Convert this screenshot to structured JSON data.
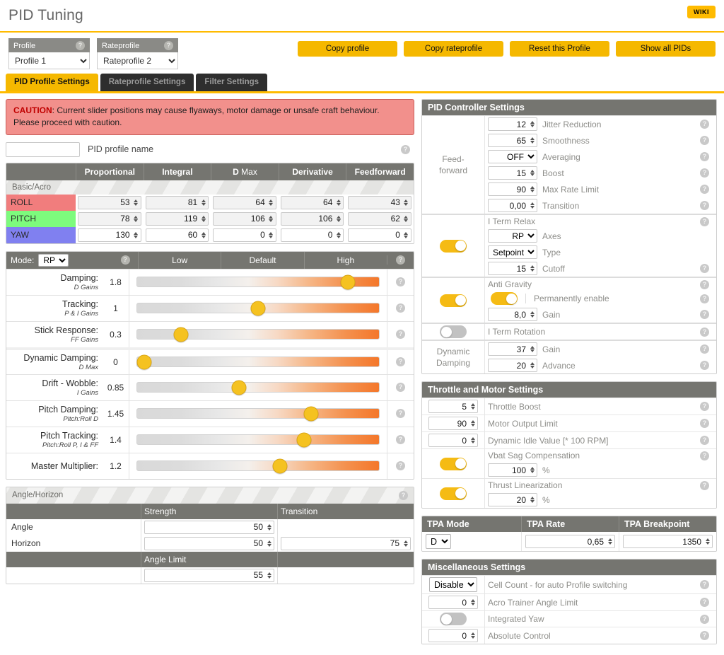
{
  "header": {
    "title": "PID Tuning",
    "wiki_label": "WIKI"
  },
  "profile_bar": {
    "profile": {
      "label": "Profile",
      "value": "Profile 1"
    },
    "rateprofile": {
      "label": "Rateprofile",
      "value": "Rateprofile 2"
    },
    "buttons": [
      {
        "label": "Copy profile"
      },
      {
        "label": "Copy rateprofile"
      },
      {
        "label": "Reset this Profile"
      },
      {
        "label": "Show all PIDs"
      }
    ]
  },
  "tabs": [
    {
      "label": "PID Profile Settings",
      "active": true
    },
    {
      "label": "Rateprofile Settings",
      "active": false
    },
    {
      "label": "Filter Settings",
      "active": false
    }
  ],
  "caution": {
    "prefix": "CAUTION",
    "text": ": Current slider positions may cause flyaways, motor damage or unsafe craft behaviour. Please proceed with caution."
  },
  "profile_name": {
    "value": "",
    "label": "PID profile name"
  },
  "pid_table": {
    "columns": [
      "",
      "Proportional",
      "Integral",
      "D Max",
      "Derivative",
      "Feedforward"
    ],
    "dmax_bold": "D",
    "dmax_rest": " Max",
    "section_label": "Basic/Acro",
    "rows": [
      {
        "axis": "ROLL",
        "values": [
          "53",
          "81",
          "64",
          "64",
          "43"
        ]
      },
      {
        "axis": "PITCH",
        "values": [
          "78",
          "119",
          "106",
          "106",
          "62"
        ]
      },
      {
        "axis": "YAW",
        "values": [
          "130",
          "60",
          "0",
          "0",
          "0"
        ]
      }
    ]
  },
  "sliders": {
    "mode_label": "Mode:",
    "mode_value": "RP",
    "columns": [
      "Low",
      "Default",
      "High"
    ],
    "rows": [
      {
        "title": "Damping:",
        "sub": "D Gains",
        "value": "1.8",
        "pos": 87
      },
      {
        "title": "Tracking:",
        "sub": "P & I Gains",
        "value": "1",
        "pos": 50
      },
      {
        "title": "Stick Response:",
        "sub": "FF Gains",
        "value": "0.3",
        "pos": 18
      },
      {
        "title": "Dynamic Damping:",
        "sub": "D Max",
        "value": "0",
        "pos": 3,
        "gap": true
      },
      {
        "title": "Drift - Wobble:",
        "sub": "I Gains",
        "value": "0.85",
        "pos": 42
      },
      {
        "title": "Pitch Damping:",
        "sub": "Pitch:Roll D",
        "value": "1.45",
        "pos": 72
      },
      {
        "title": "Pitch Tracking:",
        "sub": "Pitch:Roll P, I & FF",
        "value": "1.4",
        "pos": 69
      },
      {
        "title": "Master Multiplier:",
        "sub": "",
        "value": "1.2",
        "pos": 59
      }
    ]
  },
  "angle_horizon": {
    "title": "Angle/Horizon",
    "col_strength": "Strength",
    "col_transition": "Transition",
    "col_angle_limit": "Angle Limit",
    "angle_label": "Angle",
    "horizon_label": "Horizon",
    "angle_strength": "50",
    "horizon_strength": "50",
    "horizon_transition": "75",
    "angle_limit": "55"
  },
  "pid_controller": {
    "title": "PID Controller Settings",
    "feedforward_label_1": "Feed-",
    "feedforward_label_2": "forward",
    "feedforward": [
      {
        "value": "12",
        "label": "Jitter Reduction"
      },
      {
        "value": "65",
        "label": "Smoothness"
      },
      {
        "value": "OFF",
        "label": "Averaging",
        "select": true
      },
      {
        "value": "15",
        "label": "Boost"
      },
      {
        "value": "90",
        "label": "Max Rate Limit"
      },
      {
        "value": "0,00",
        "label": "Transition"
      }
    ],
    "iterm_relax": {
      "label": "I Term Relax",
      "enabled": true,
      "axes_value": "RP",
      "axes_label": "Axes",
      "type_value": "Setpoint",
      "type_label": "Type",
      "cutoff_value": "15",
      "cutoff_label": "Cutoff"
    },
    "anti_gravity": {
      "label": "Anti Gravity",
      "enabled": true,
      "permanent_label": "Permanently enable",
      "permanent_enabled": true,
      "gain_value": "8,0",
      "gain_label": "Gain"
    },
    "iterm_rotation": {
      "label": "I Term Rotation",
      "enabled": false
    },
    "dynamic_damping": {
      "label_1": "Dynamic",
      "label_2": "Damping",
      "gain_value": "37",
      "gain_label": "Gain",
      "advance_value": "20",
      "advance_label": "Advance"
    }
  },
  "throttle_motor": {
    "title": "Throttle and Motor Settings",
    "rows": [
      {
        "value": "5",
        "label": "Throttle Boost"
      },
      {
        "value": "90",
        "label": "Motor Output Limit"
      },
      {
        "value": "0",
        "label": "Dynamic Idle Value [* 100 RPM]"
      }
    ],
    "vbat_sag": {
      "label": "Vbat Sag Compensation",
      "enabled": true,
      "value": "100",
      "unit": "%"
    },
    "thrust_lin": {
      "label": "Thrust Linearization",
      "enabled": true,
      "value": "20",
      "unit": "%"
    }
  },
  "tpa": {
    "mode_header": "TPA Mode",
    "rate_header": "TPA Rate",
    "breakpoint_header": "TPA Breakpoint",
    "mode_value": "D",
    "rate_value": "0,65",
    "breakpoint_value": "1350"
  },
  "misc": {
    "title": "Miscellaneous Settings",
    "cell_count": {
      "value": "Disable",
      "label": "Cell Count - for auto Profile switching"
    },
    "acro_trainer": {
      "value": "0",
      "label": "Acro Trainer Angle Limit"
    },
    "integrated_yaw": {
      "label": "Integrated Yaw",
      "enabled": false
    },
    "absolute_control": {
      "value": "0",
      "label": "Absolute Control"
    }
  },
  "icons": {
    "help": "?"
  }
}
